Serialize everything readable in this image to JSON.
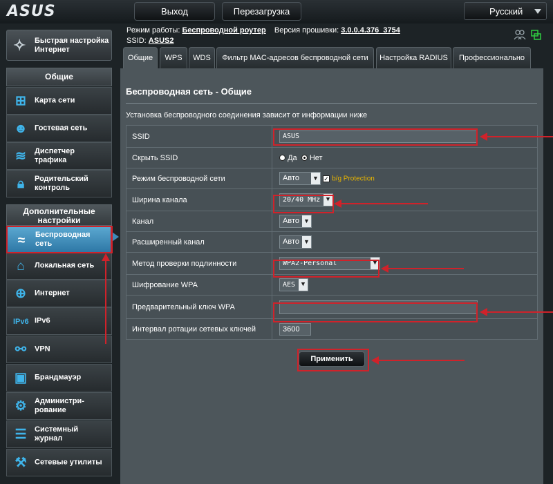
{
  "brand": {
    "logo": "ASUS"
  },
  "topbar": {
    "logout": "Выход",
    "reboot": "Перезагрузка",
    "language": "Русский"
  },
  "status": {
    "mode_label": "Режим работы:",
    "mode_value": "Беспроводной роутер",
    "fw_label": "Версия прошивки:",
    "fw_value": "3.0.0.4.376_3754",
    "ssid_label": "SSID:",
    "ssid_value": "ASUS2"
  },
  "sidebar": {
    "quick_setup": "Быстрая настройка Интернет",
    "general_header": "Общие",
    "general_items": [
      {
        "label": "Карта сети",
        "icon": "network-map-icon"
      },
      {
        "label": "Гостевая сеть",
        "icon": "guest-network-icon"
      },
      {
        "label": "Диспетчер трафика",
        "icon": "traffic-manager-icon"
      },
      {
        "label": "Родительский контроль",
        "icon": "parental-control-icon"
      }
    ],
    "advanced_header": "Дополнительные настройки",
    "advanced_items": [
      {
        "label": "Беспроводная сеть",
        "icon": "wireless-icon",
        "active": true
      },
      {
        "label": "Локальная сеть",
        "icon": "lan-icon"
      },
      {
        "label": "Интернет",
        "icon": "internet-icon"
      },
      {
        "label": "IPv6",
        "icon": "ipv6-icon"
      },
      {
        "label": "VPN",
        "icon": "vpn-icon"
      },
      {
        "label": "Брандмауэр",
        "icon": "firewall-icon"
      },
      {
        "label": "Администри-рование",
        "icon": "administration-icon"
      },
      {
        "label": "Системный журнал",
        "icon": "system-log-icon"
      },
      {
        "label": "Сетевые утилиты",
        "icon": "network-tools-icon"
      }
    ]
  },
  "tabs": [
    {
      "label": "Общие",
      "active": true
    },
    {
      "label": "WPS"
    },
    {
      "label": "WDS"
    },
    {
      "label": "Фильтр MAC-адресов беспроводной сети"
    },
    {
      "label": "Настройка RADIUS"
    },
    {
      "label": "Профессионально"
    }
  ],
  "panel": {
    "title": "Беспроводная сеть - Общие",
    "description": "Установка беспроводного соединения зависит от информации ниже",
    "rows": {
      "ssid": {
        "label": "SSID",
        "value": "ASUS"
      },
      "hide_ssid": {
        "label": "Скрыть SSID",
        "yes": "Да",
        "no": "Нет",
        "selected": "no"
      },
      "mode": {
        "label": "Режим беспроводной сети",
        "value": "Авто",
        "bg_protection": "b/g Protection"
      },
      "channel_width": {
        "label": "Ширина канала",
        "value": "20/40 MHz"
      },
      "channel": {
        "label": "Канал",
        "value": "Авто"
      },
      "ext_channel": {
        "label": "Расширенный канал",
        "value": "Авто"
      },
      "auth": {
        "label": "Метод проверки подлинности",
        "value": "WPA2-Personal"
      },
      "encryption": {
        "label": "Шифрование WPA",
        "value": "AES"
      },
      "psk": {
        "label": "Предварительный ключ WPA",
        "value": ""
      },
      "rotation": {
        "label": "Интервал ротации сетевых ключей",
        "value": "3600"
      }
    },
    "apply": "Применить"
  },
  "colors": {
    "accent_red": "#d0222a",
    "active_blue": "#3f8ab8",
    "icon_blue": "#3fb4ea",
    "bg_protection": "#e8b500"
  }
}
